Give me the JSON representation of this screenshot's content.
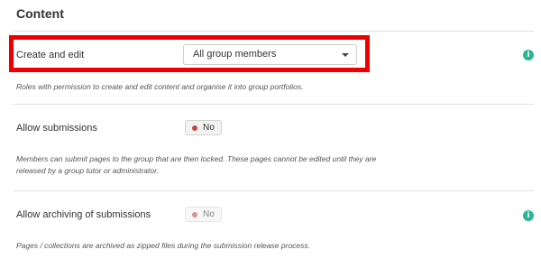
{
  "section": {
    "title": "Content"
  },
  "settings": [
    {
      "label": "Create and edit",
      "select_value": "All group members",
      "description": "Roles with permission to create and edit content and organise it into group portfolios."
    },
    {
      "label": "Allow submissions",
      "toggle_value": "No",
      "description_line1": "Members can submit pages to the group that are then locked. These pages cannot be edited until they are",
      "description_line2": "released by a group tutor or administrator."
    },
    {
      "label": "Allow archiving of submissions",
      "toggle_value": "No",
      "description": "Pages / collections are archived as zipped files during the submission release process."
    }
  ],
  "icons": {
    "info": "i"
  },
  "colors": {
    "highlight": "#ee0000",
    "info": "#2fb493",
    "toggle_dot": "#b94a48"
  }
}
